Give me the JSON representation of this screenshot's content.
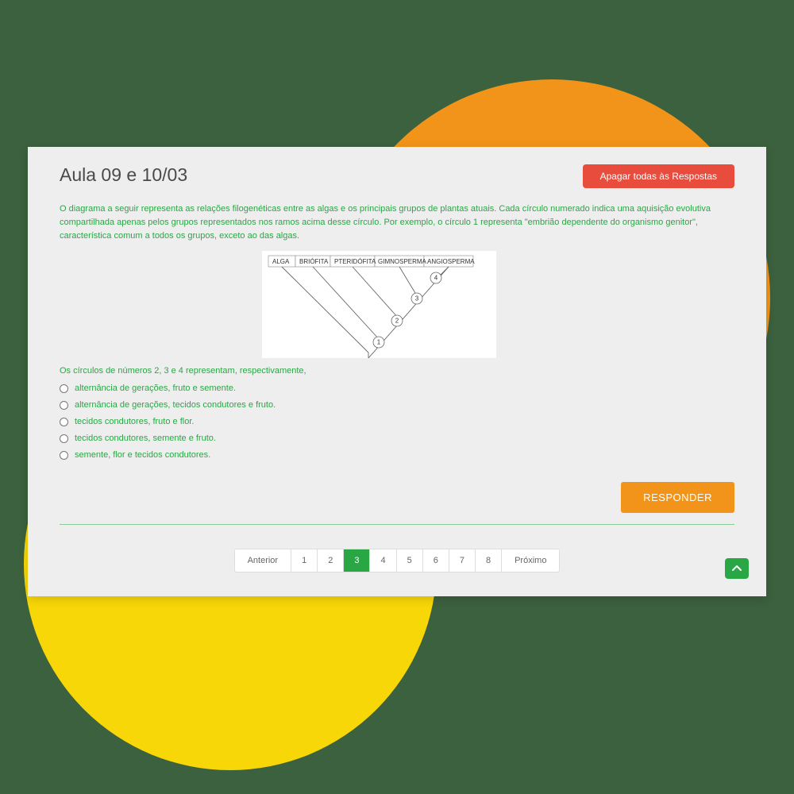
{
  "title": "Aula 09 e 10/03",
  "clearButton": "Apagar todas às Respostas",
  "questionText": "O diagrama a seguir representa as relações filogenéticas entre as algas e os principais grupos de plantas atuais. Cada círculo numerado indica uma aquisição evolutiva compartilhada apenas pelos grupos representados nos ramos acima desse círculo. Por exemplo, o círculo 1 representa \"embrião dependente do organismo genitor\", característica comum a todos os grupos, exceto ao das algas.",
  "diagram": {
    "labels": [
      "ALGA",
      "BRIÓFITA",
      "PTERIDÓFITA",
      "GIMNOSPERMA",
      "ANGIOSPERMA"
    ],
    "nodes": [
      "1",
      "2",
      "3",
      "4"
    ]
  },
  "subQuestion": "Os círculos de números 2, 3 e 4 representam, respectivamente,",
  "options": [
    "alternância de gerações, fruto e semente.",
    "alternância de gerações, tecidos condutores e fruto.",
    "tecidos condutores, fruto e flor.",
    "tecidos condutores, semente e fruto.",
    "semente, flor e tecidos condutores."
  ],
  "respondButton": "RESPONDER",
  "pagination": {
    "prev": "Anterior",
    "next": "Próximo",
    "pages": [
      "1",
      "2",
      "3",
      "4",
      "5",
      "6",
      "7",
      "8"
    ],
    "active": "3"
  }
}
